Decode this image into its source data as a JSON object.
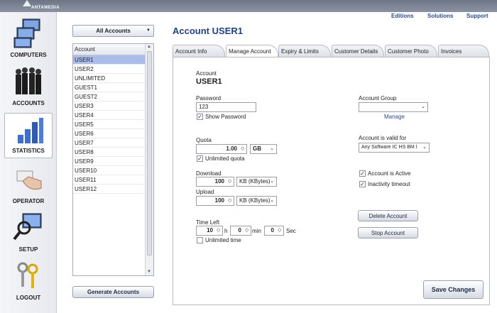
{
  "brand": {
    "logo_text": "ANTAMEDIA",
    "dim_title": ""
  },
  "sidebar": {
    "items": [
      {
        "label": "COMPUTERS"
      },
      {
        "label": "ACCOUNTS"
      },
      {
        "label": "STATISTICS"
      },
      {
        "label": "OPERATOR"
      },
      {
        "label": "SETUP"
      },
      {
        "label": "LOGOUT"
      }
    ]
  },
  "topnav": {
    "editions": "Editions",
    "solutions": "Solutions",
    "support": "Support"
  },
  "accounts_filter": {
    "value": "All Accounts"
  },
  "account_list": {
    "header": "Account",
    "rows": [
      "USER1",
      "USER2",
      "UNLIMITED",
      "GUEST1",
      "GUEST2",
      "USER3",
      "USER4",
      "USER5",
      "USER6",
      "USER7",
      "USER8",
      "USER9",
      "USER10",
      "USER11",
      "USER12"
    ],
    "selected": "USER1"
  },
  "generate_button": "Generate Accounts",
  "page_title": "Account  USER1",
  "tabs": [
    {
      "label": "Account Info"
    },
    {
      "label": "Manage Account"
    },
    {
      "label": "Expiry & Limits"
    },
    {
      "label": "Customer Details"
    },
    {
      "label": "Customer Photo"
    },
    {
      "label": "Invoices"
    }
  ],
  "form": {
    "account_label": "Account",
    "account_value": "USER1",
    "password_label": "Password",
    "password_value": "123",
    "show_password": "Show Password",
    "quota_label": "Quota",
    "quota_value": "1.00",
    "quota_unit": "GB",
    "unlimited_quota": "Unlimited quota",
    "download_label": "Download",
    "download_value": "100",
    "download_unit": "KB (KBytes)",
    "upload_label": "Upload",
    "upload_value": "100",
    "upload_unit": "KB (KBytes)",
    "time_left_label": "Time Left",
    "hours_value": "10",
    "hours_unit": "h",
    "minutes_value": "0",
    "minutes_unit": "min",
    "seconds_value": "0",
    "seconds_unit": "Sec",
    "unlimited_time": "Unlimited time",
    "account_group_label": "Account Group",
    "account_group_value": "",
    "manage_link": "Manage",
    "valid_for_label": "Account is valid for",
    "valid_for_value": "Any Software IC HS BM I",
    "is_active": "Account is Active",
    "inactivity_timeout": "Inactivity timeout",
    "delete_button": "Delete Account",
    "stop_button": "Stop Account",
    "save_button": "Save Changes",
    "check_mark": "✓"
  }
}
